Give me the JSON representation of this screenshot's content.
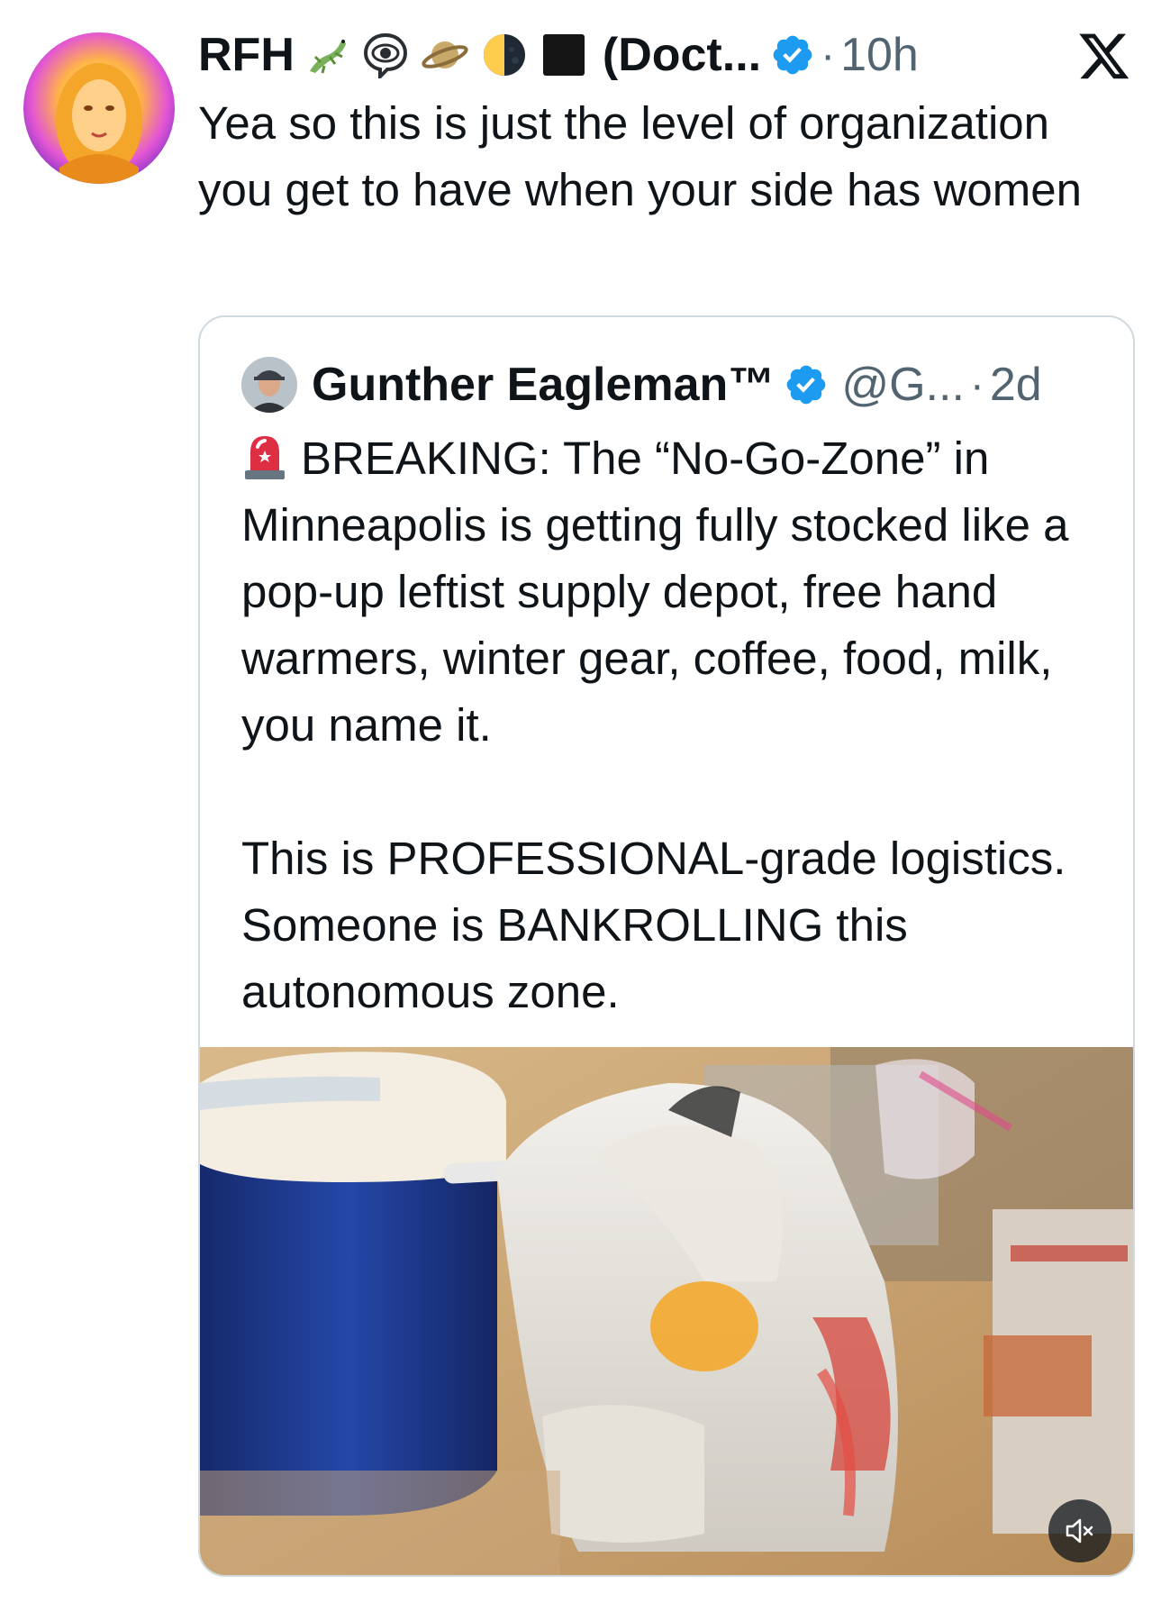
{
  "post": {
    "display_name": "RFH",
    "name_suffix": "(Doct...",
    "separator": "·",
    "timestamp": "10h",
    "emoji_icons": [
      "lizard-emoji",
      "eye-in-speech-bubble-emoji",
      "ringed-planet-emoji",
      "last-quarter-moon-emoji",
      "black-large-square-emoji"
    ],
    "text": "Yea so this is just the level of organization you get to have when your side has women"
  },
  "quoted_post": {
    "display_name": "Gunther Eagleman™",
    "handle": "@G...",
    "separator": "·",
    "timestamp": "2d",
    "paragraph_1": "BREAKING: The “No-Go-Zone” in Minneapolis is getting fully stocked like a pop-up leftist supply depot, free hand warmers, winter gear, coffee, food, milk, you name it.",
    "paragraph_2": "This is PROFESSIONAL-grade logistics. Someone is BANKROLLING this autonomous zone.",
    "leading_emoji": "police-car-light-emoji"
  },
  "icons": {
    "verified": "verified-badge-icon",
    "platform_logo": "x-logo-icon",
    "mute": "volume-muted-icon"
  },
  "colors": {
    "text_primary": "#0f1419",
    "text_secondary": "#536471",
    "verified_blue": "#1d9bf0",
    "card_border": "#cfd9de"
  }
}
